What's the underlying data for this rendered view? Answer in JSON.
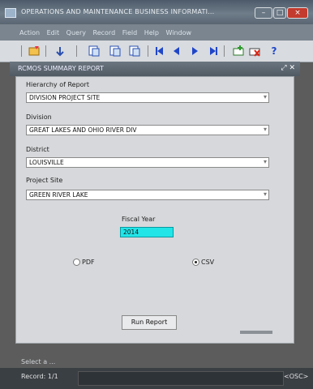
{
  "window": {
    "title": "OPERATIONS AND MAINTENANCE BUSINESS INFORMATI...",
    "controls": {
      "minimize": "–",
      "maximize": "□",
      "close": "×"
    }
  },
  "menu": [
    "Action",
    "Edit",
    "Query",
    "Record",
    "Field",
    "Help",
    "Window"
  ],
  "toolbar": {
    "icons": [
      "save-icon",
      "add-icon",
      "copy-icon",
      "print-icon",
      "refresh-icon",
      "first-icon",
      "previous-icon",
      "next-icon",
      "last-icon",
      "new-record-icon",
      "delete-record-icon",
      "help-icon"
    ],
    "help_glyph": "?"
  },
  "subwindow": {
    "title": "RCMOS SUMMARY REPORT"
  },
  "form": {
    "hierarchy": {
      "label": "Hierarchy of Report",
      "value": "DIVISION PROJECT SITE"
    },
    "division": {
      "label": "Division",
      "value": "GREAT LAKES AND OHIO RIVER DIV"
    },
    "district": {
      "label": "District",
      "value": "LOUISVILLE"
    },
    "project_site": {
      "label": "Project Site",
      "value": "GREEN RIVER LAKE"
    },
    "fiscal_year": {
      "label": "Fiscal Year",
      "value": "2014"
    },
    "format_pdf": {
      "label": "PDF",
      "selected": false
    },
    "format_csv": {
      "label": "CSV",
      "selected": true
    },
    "run_button": "Run Report"
  },
  "colors": {
    "fiscal_year_bg": "#22e5e8",
    "panel": "#d6d8db"
  },
  "status": {
    "hint": "Select a ...",
    "record": "Record: 1/1",
    "mode": "<OSC>"
  }
}
